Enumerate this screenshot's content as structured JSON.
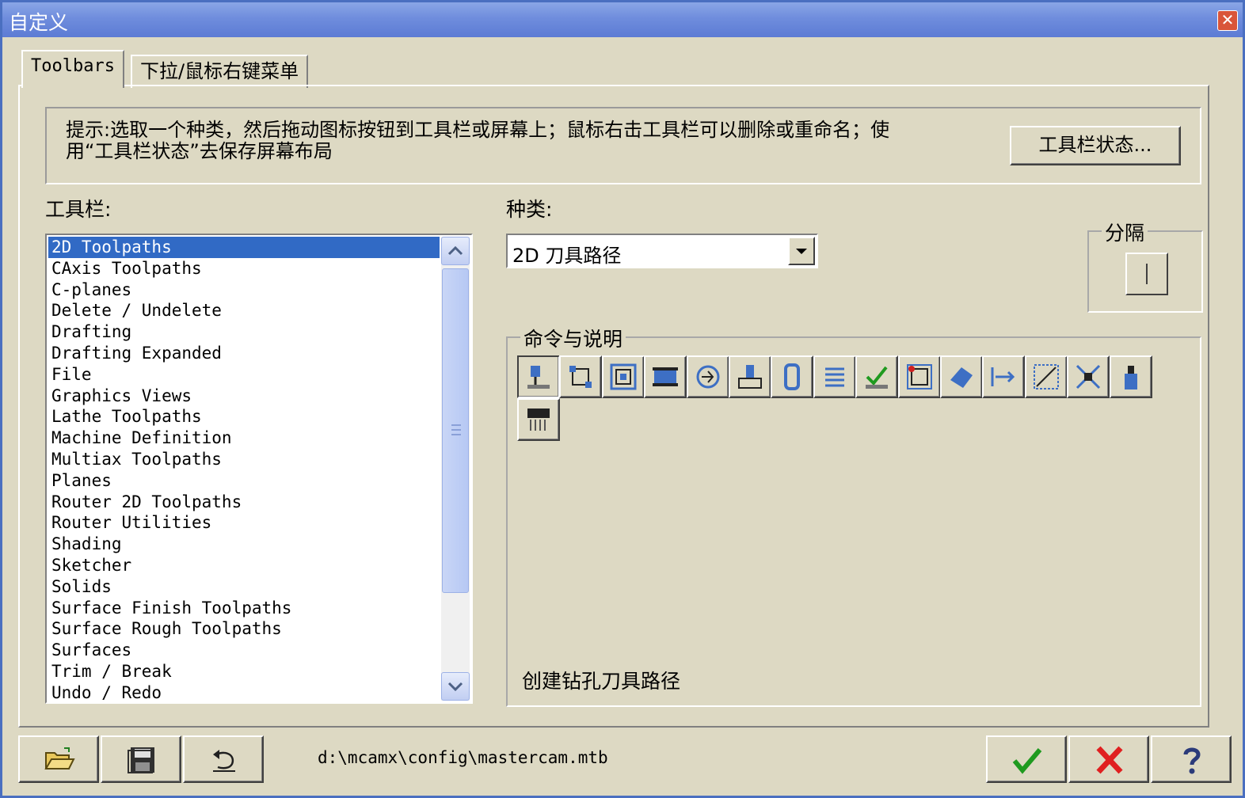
{
  "window": {
    "title": "自定义"
  },
  "tabs": [
    {
      "label": "Toolbars",
      "active": true
    },
    {
      "label": "下拉/鼠标右键菜单",
      "active": false
    }
  ],
  "hint": {
    "line1": "提示:选取一个种类，然后拖动图标按钮到工具栏或屏幕上；鼠标右击工具栏可以删除或重命名；使",
    "line2": "用“工具栏状态”去保存屏幕布局",
    "button": "工具栏状态..."
  },
  "toolbar_list": {
    "label": "工具栏:",
    "items": [
      "2D Toolpaths",
      "CAxis Toolpaths",
      "C-planes",
      "Delete / Undelete",
      "Drafting",
      "Drafting Expanded",
      "File",
      "Graphics Views",
      "Lathe Toolpaths",
      "Machine Definition",
      "Multiax Toolpaths",
      "Planes",
      "Router 2D Toolpaths",
      "Router Utilities",
      "Shading",
      "Sketcher",
      "Solids",
      "Surface Finish Toolpaths",
      "Surface Rough Toolpaths",
      "Surfaces",
      "Trim / Break",
      "Undo / Redo"
    ],
    "selected_index": 0
  },
  "category": {
    "label": "种类:",
    "value": "2D 刀具路径"
  },
  "separator_group": {
    "label": "分隔"
  },
  "commands": {
    "label": "命令与说明",
    "icons": [
      "drill-toolpath-icon",
      "contour-toolpath-icon",
      "pocket-toolpath-icon",
      "facing-toolpath-icon",
      "circle-mill-icon",
      "slot-mill-icon",
      "thread-mill-icon",
      "helix-bore-icon",
      "point-toolpath-icon",
      "high-speed-toolpath-icon",
      "engraving-toolpath-icon",
      "transform-toolpath-icon",
      "trim-toolpath-icon",
      "nest-toolpath-icon",
      "tool-manager-icon",
      "block-drill-icon"
    ],
    "description": "创建钻孔刀具路径"
  },
  "footer": {
    "file_path": "d:\\mcamx\\config\\mastercam.mtb"
  },
  "colors": {
    "accent": "#316ac5",
    "dialog_bg": "#ddd9c3",
    "title_bar": "#6f8ddd"
  }
}
